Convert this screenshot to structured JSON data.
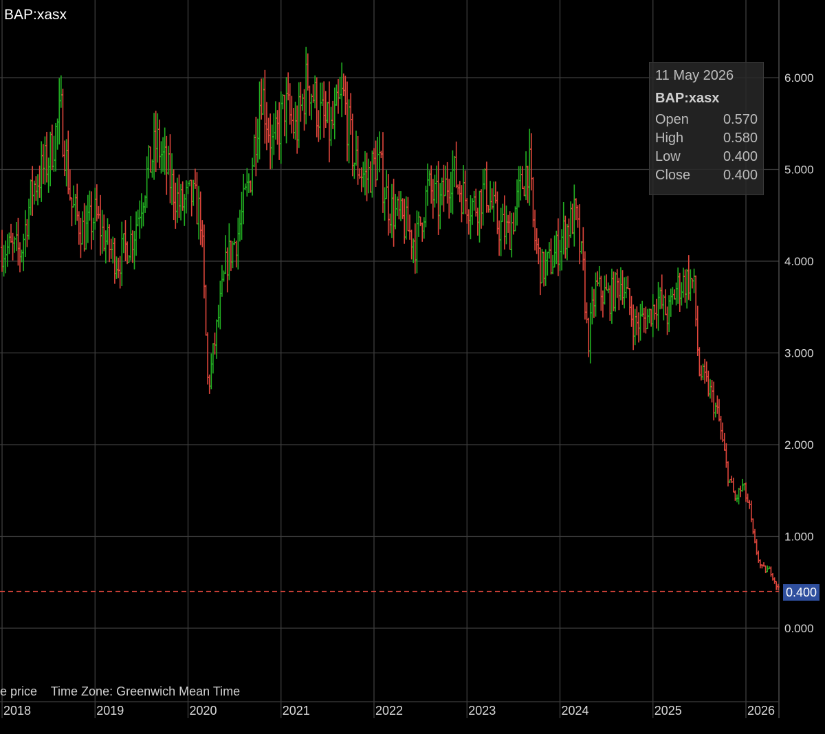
{
  "chart_data": {
    "type": "ohlc",
    "title": "BAP:xasx",
    "x_ticks": [
      "2018",
      "2019",
      "2020",
      "2021",
      "2022",
      "2023",
      "2024",
      "2025",
      "2026"
    ],
    "y_ticks": [
      "0.000",
      "1.000",
      "2.000",
      "3.000",
      "4.000",
      "5.000",
      "6.000"
    ],
    "ylim": [
      0,
      6.0
    ],
    "grid": true,
    "last_price": 0.4,
    "last_price_label": "0.400",
    "bull_color": "#22b022",
    "bear_color": "#e0463c",
    "last_price_line_color": "#e0463c",
    "price_path": [
      [
        "2018-01-01",
        4.15
      ],
      [
        "2018-03-15",
        4.1
      ],
      [
        "2018-05-01",
        4.8
      ],
      [
        "2018-07-01",
        5.1
      ],
      [
        "2018-08-20",
        5.6
      ],
      [
        "2018-10-01",
        4.6
      ],
      [
        "2018-11-20",
        4.3
      ],
      [
        "2019-01-01",
        4.5
      ],
      [
        "2019-02-15",
        4.2
      ],
      [
        "2019-04-01",
        4.0
      ],
      [
        "2019-06-01",
        4.3
      ],
      [
        "2019-07-20",
        4.9
      ],
      [
        "2019-09-01",
        5.3
      ],
      [
        "2019-10-20",
        4.9
      ],
      [
        "2019-12-01",
        4.6
      ],
      [
        "2020-01-15",
        4.7
      ],
      [
        "2020-02-20",
        4.5
      ],
      [
        "2020-03-20",
        2.6
      ],
      [
        "2020-04-20",
        3.2
      ],
      [
        "2020-06-01",
        4.0
      ],
      [
        "2020-07-15",
        4.3
      ],
      [
        "2020-09-01",
        4.9
      ],
      [
        "2020-10-15",
        5.9
      ],
      [
        "2020-12-01",
        5.2
      ],
      [
        "2021-01-15",
        5.7
      ],
      [
        "2021-03-01",
        5.4
      ],
      [
        "2021-04-15",
        6.0
      ],
      [
        "2021-06-01",
        5.6
      ],
      [
        "2021-07-15",
        5.4
      ],
      [
        "2021-09-01",
        5.8
      ],
      [
        "2021-10-15",
        5.1
      ],
      [
        "2021-12-01",
        4.9
      ],
      [
        "2022-01-15",
        5.1
      ],
      [
        "2022-03-01",
        4.6
      ],
      [
        "2022-05-01",
        4.4
      ],
      [
        "2022-06-15",
        4.2
      ],
      [
        "2022-08-01",
        4.8
      ],
      [
        "2022-09-15",
        4.6
      ],
      [
        "2022-11-01",
        5.0
      ],
      [
        "2022-12-20",
        4.7
      ],
      [
        "2023-02-01",
        4.6
      ],
      [
        "2023-03-15",
        4.8
      ],
      [
        "2023-05-01",
        4.4
      ],
      [
        "2023-06-15",
        4.3
      ],
      [
        "2023-08-01",
        4.8
      ],
      [
        "2023-09-01",
        5.1
      ],
      [
        "2023-09-20",
        4.3
      ],
      [
        "2023-10-20",
        3.9
      ],
      [
        "2023-12-01",
        4.0
      ],
      [
        "2024-01-15",
        4.3
      ],
      [
        "2024-03-01",
        4.5
      ],
      [
        "2024-04-01",
        3.9
      ],
      [
        "2024-04-20",
        3.1
      ],
      [
        "2024-05-20",
        3.7
      ],
      [
        "2024-07-15",
        3.6
      ],
      [
        "2024-09-01",
        3.8
      ],
      [
        "2024-10-20",
        3.3
      ],
      [
        "2024-12-15",
        3.4
      ],
      [
        "2025-01-20",
        3.6
      ],
      [
        "2025-03-01",
        3.4
      ],
      [
        "2025-04-01",
        3.7
      ],
      [
        "2025-05-15",
        3.8
      ],
      [
        "2025-06-10",
        3.75
      ],
      [
        "2025-07-01",
        2.8
      ],
      [
        "2025-08-10",
        2.6
      ],
      [
        "2025-09-15",
        2.3
      ],
      [
        "2025-10-20",
        1.7
      ],
      [
        "2025-11-20",
        1.4
      ],
      [
        "2025-12-20",
        1.55
      ],
      [
        "2026-01-15",
        1.3
      ],
      [
        "2026-02-01",
        0.95
      ],
      [
        "2026-03-01",
        0.65
      ],
      [
        "2026-04-10",
        0.62
      ],
      [
        "2026-05-11",
        0.4
      ]
    ]
  },
  "tooltip": {
    "date": "11 May 2026",
    "symbol": "BAP:xasx",
    "rows": [
      {
        "label": "Open",
        "value": "0.570"
      },
      {
        "label": "High",
        "value": "0.580"
      },
      {
        "label": "Low",
        "value": "0.400"
      },
      {
        "label": "Close",
        "value": "0.400"
      }
    ]
  },
  "footer": {
    "price_note": "e price",
    "timezone": "Time Zone: Greenwich Mean Time"
  }
}
